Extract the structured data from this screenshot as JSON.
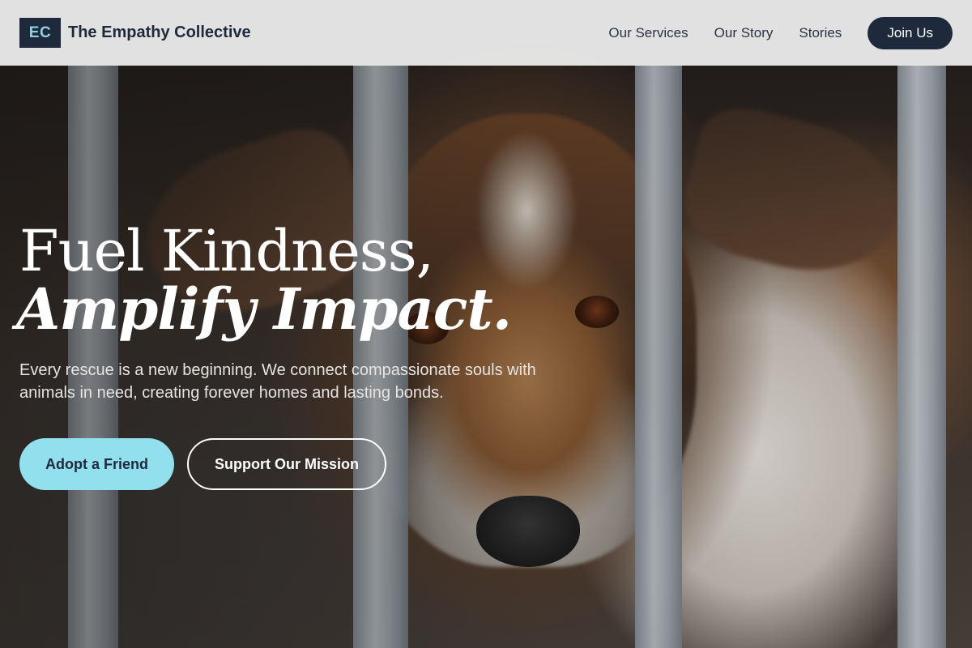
{
  "header": {
    "logo_text": "EC",
    "brand_name": "The Empathy Collective",
    "nav": [
      {
        "label": "Our Services"
      },
      {
        "label": "Our Story"
      },
      {
        "label": "Stories"
      }
    ],
    "join_label": "Join Us"
  },
  "hero": {
    "headline_line1": "Fuel Kindness,",
    "headline_line2": "Amplify Impact.",
    "subtitle": "Every rescue is a new beginning. We connect compassionate souls with animals in need, creating forever homes and lasting bonds.",
    "primary_cta": "Adopt a Friend",
    "secondary_cta": "Support Our Mission"
  },
  "colors": {
    "navy": "#1e2a3c",
    "accent": "#92dfee",
    "header_bg": "#eeeeee"
  }
}
